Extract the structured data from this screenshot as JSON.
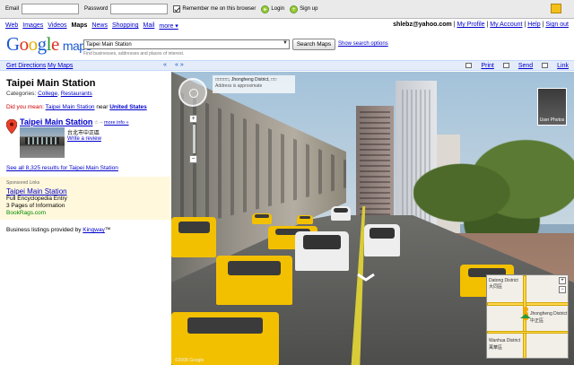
{
  "topbar": {
    "email_label": "Email",
    "password_label": "Password",
    "remember_label": "Remember me on this browser",
    "login_label": "Login",
    "signup_label": "Sign up"
  },
  "nav": {
    "items": [
      "Web",
      "Images",
      "Videos",
      "Maps",
      "News",
      "Shopping",
      "Mail",
      "more ▾"
    ]
  },
  "user": {
    "email": "shlebz@yahoo.com",
    "my_profile": "My Profile",
    "my_account": "My Account",
    "help": "Help",
    "sign_out": "Sign out"
  },
  "logo": {
    "letters": [
      "G",
      "o",
      "o",
      "g",
      "l",
      "e"
    ],
    "product": "maps"
  },
  "search": {
    "value": "Taipei Main Station",
    "button": "Search Maps",
    "options_link": "Show search options",
    "hint": "Find businesses, addresses and places of interest."
  },
  "strip": {
    "get_directions": "Get Directions",
    "my_maps": "My Maps",
    "collapse": "«",
    "expand": "« »",
    "print": "Print",
    "send": "Send",
    "link": "Link"
  },
  "left": {
    "title": "Taipei Main Station",
    "categories_label": "Categories:",
    "categories": [
      "College",
      "Restaurants"
    ],
    "did_you_mean_label": "Did you mean:",
    "did_you_mean_link": "Taipei Main Station",
    "near_text": "near",
    "near_place": "United States",
    "result_title": "Taipei Main Station",
    "more_info": "more info »",
    "result_addr": "台北市中正區",
    "write_review": "Write a review",
    "see_all": "See all 8,325 results for Taipei Main Station",
    "ads_label": "Sponsored Links",
    "ad_title": "Taipei Main Station",
    "ad_line1": "Full Encyclopedia Entry",
    "ad_line2": "3 Pages of Information",
    "ad_url": "BookRags.com",
    "biz_label": "Business listings provided by",
    "biz_link": "Kingway",
    "biz_tm": "™"
  },
  "streetview": {
    "addr_line1": "□□□□□, Jhongheng District, □□",
    "addr_line2": "Address is approximate",
    "user_photos": "User Photos",
    "compass_n": "N",
    "zoom_in": "+",
    "zoom_out": "−",
    "copyright": "©2008 Google"
  },
  "minimap": {
    "labels": [
      "Datong District",
      "大同區",
      "Jhongheng District",
      "中正區",
      "Wanhua District",
      "萬華區"
    ],
    "zoom_in": "+",
    "zoom_out": "−"
  },
  "colors": {
    "link": "#0000cc",
    "strip_bg": "#e5ecf9",
    "ads_bg": "#fff8dc",
    "taxi": "#f3c000"
  }
}
